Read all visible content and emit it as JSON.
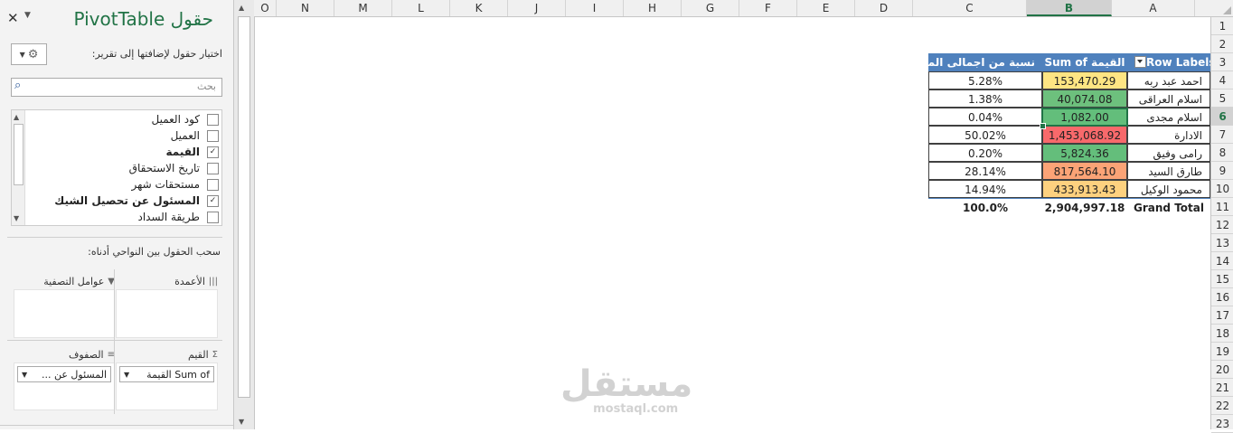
{
  "pane": {
    "title": "حقول PivotTable",
    "subtitle": "اختيار حقول لإضافتها إلى تقرير:",
    "search_placeholder": "بحث",
    "fields": [
      {
        "label": "كود العميل",
        "checked": false,
        "bold": false
      },
      {
        "label": "العميل",
        "checked": false,
        "bold": false
      },
      {
        "label": "القيمة",
        "checked": true,
        "bold": true
      },
      {
        "label": "تاريخ الاستحقاق",
        "checked": false,
        "bold": false
      },
      {
        "label": "مستحقات شهر",
        "checked": false,
        "bold": false
      },
      {
        "label": "المسئول عن تحصيل الشيك",
        "checked": true,
        "bold": true
      },
      {
        "label": "طريقة السداد",
        "checked": false,
        "bold": false
      }
    ],
    "drag_hint": "سحب الحقول بين النواحي أدناه:",
    "areas": {
      "filters_label": "عوامل التصفية",
      "columns_label": "الأعمدة",
      "rows_label": "الصفوف",
      "values_label": "القيم",
      "rows_item": "المسئول عن ...",
      "values_item": "Sum of القيمة"
    }
  },
  "sheet": {
    "columns": [
      "O",
      "N",
      "M",
      "L",
      "K",
      "J",
      "I",
      "H",
      "G",
      "F",
      "E",
      "D",
      "C",
      "B",
      "A"
    ],
    "selected_column": "B",
    "rows": [
      "1",
      "2",
      "3",
      "4",
      "5",
      "6",
      "7",
      "8",
      "9",
      "10",
      "11",
      "12",
      "13",
      "14",
      "15",
      "16",
      "17",
      "18",
      "19",
      "20",
      "21",
      "22",
      "23"
    ],
    "selected_row": "6"
  },
  "pivot": {
    "header_labels": "Row Labels",
    "header_sum": "Sum of القيمة",
    "header_pct": "نسبة من اجمالى المديونية",
    "rows": [
      {
        "label": "احمد عبد ربه",
        "value": "153,470.29",
        "pct": "5.28%",
        "color": "#fee583"
      },
      {
        "label": "اسلام العراقى",
        "value": "40,074.08",
        "pct": "1.38%",
        "color": "#6dc07d"
      },
      {
        "label": "اسلام مجدى",
        "value": "1,082.00",
        "pct": "0.04%",
        "color": "#63be7b"
      },
      {
        "label": "الادارة",
        "value": "1,453,068.92",
        "pct": "50.02%",
        "color": "#f8696b"
      },
      {
        "label": "رامى  وفيق",
        "value": "5,824.36",
        "pct": "0.20%",
        "color": "#64be7b"
      },
      {
        "label": "طارق السيد",
        "value": "817,564.10",
        "pct": "28.14%",
        "color": "#fba376"
      },
      {
        "label": "محمود الوكيل",
        "value": "433,913.43",
        "pct": "14.94%",
        "color": "#fdd17f"
      }
    ],
    "total_label": "Grand Total",
    "total_value": "2,904,997.18",
    "total_pct": "100.0%"
  },
  "watermark": {
    "arabic": "مستقل",
    "latin": "mostaql.com"
  }
}
